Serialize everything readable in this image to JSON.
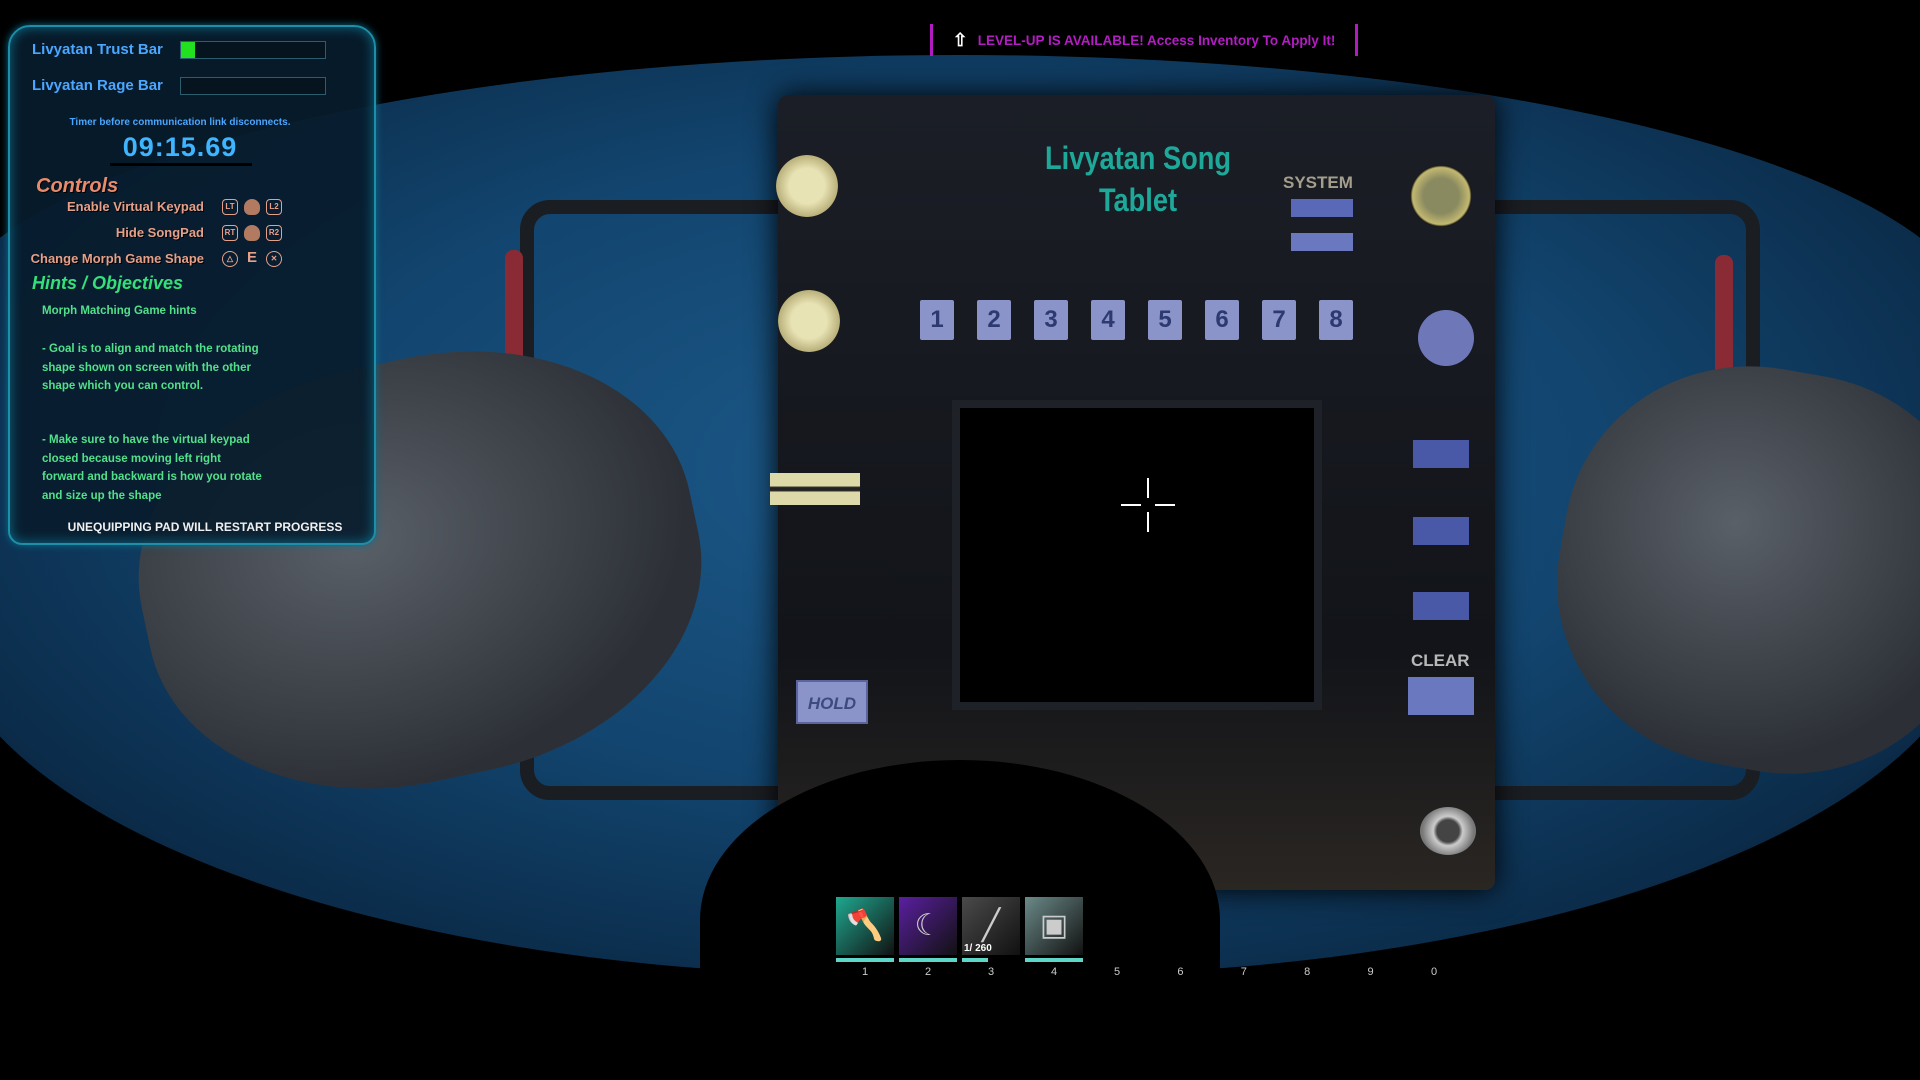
{
  "hud": {
    "trust_bar": {
      "label": "Livyatan Trust Bar",
      "fill_percent": 10,
      "color": "#22e01f"
    },
    "rage_bar": {
      "label": "Livyatan Rage Bar",
      "fill_percent": 0
    },
    "timer_caption": "Timer before communication link disconnects.",
    "timer": "09:15.69",
    "controls": {
      "heading": "Controls",
      "items": [
        {
          "label": "Enable Virtual Keypad",
          "icons": [
            "LT",
            "mouse-left",
            "L2"
          ]
        },
        {
          "label": "Hide SongPad",
          "icons": [
            "RT",
            "mouse-right",
            "R2"
          ]
        },
        {
          "label": "Change Morph Game Shape",
          "icons": [
            "triangle",
            "E",
            "cross"
          ]
        }
      ]
    },
    "hints": {
      "heading": "Hints / Objectives",
      "subtitle": "Morph Matching Game hints",
      "paragraphs": [
        "- Goal is to align and match the rotating shape shown on screen with the other shape which you can control.",
        "- Make sure to have the virtual keypad closed because moving left right forward and backward is how you rotate and size up the shape"
      ]
    },
    "warning": "UNEQUIPPING PAD WILL RESTART PROGRESS"
  },
  "banner": {
    "text": "LEVEL-UP IS AVAILABLE! Access Inventory To Apply It!",
    "icon": "level-up-arrow-icon",
    "color": "#b41cc4"
  },
  "tablet": {
    "title_line1": "Livyatan Song",
    "title_line2": "Tablet",
    "system_label": "SYSTEM",
    "pads": [
      "1",
      "2",
      "3",
      "4",
      "5",
      "6",
      "7",
      "8"
    ],
    "clear_label": "CLEAR",
    "hold_label": "HOLD"
  },
  "hotbar": {
    "slots": [
      {
        "key": "1",
        "item": "hatchet",
        "bg": "#1fa890",
        "durability": 1.0
      },
      {
        "key": "2",
        "item": "sickle",
        "bg": "#5a1fa0",
        "durability": 1.0
      },
      {
        "key": "3",
        "item": "rifle",
        "bg": "#4a4a4a",
        "durability": 0.45,
        "count": "1/ 260"
      },
      {
        "key": "4",
        "item": "song-tablet",
        "bg": "#6a8a88",
        "durability": 1.0
      },
      {
        "key": "5"
      },
      {
        "key": "6"
      },
      {
        "key": "7"
      },
      {
        "key": "8"
      },
      {
        "key": "9"
      },
      {
        "key": "0"
      }
    ]
  }
}
